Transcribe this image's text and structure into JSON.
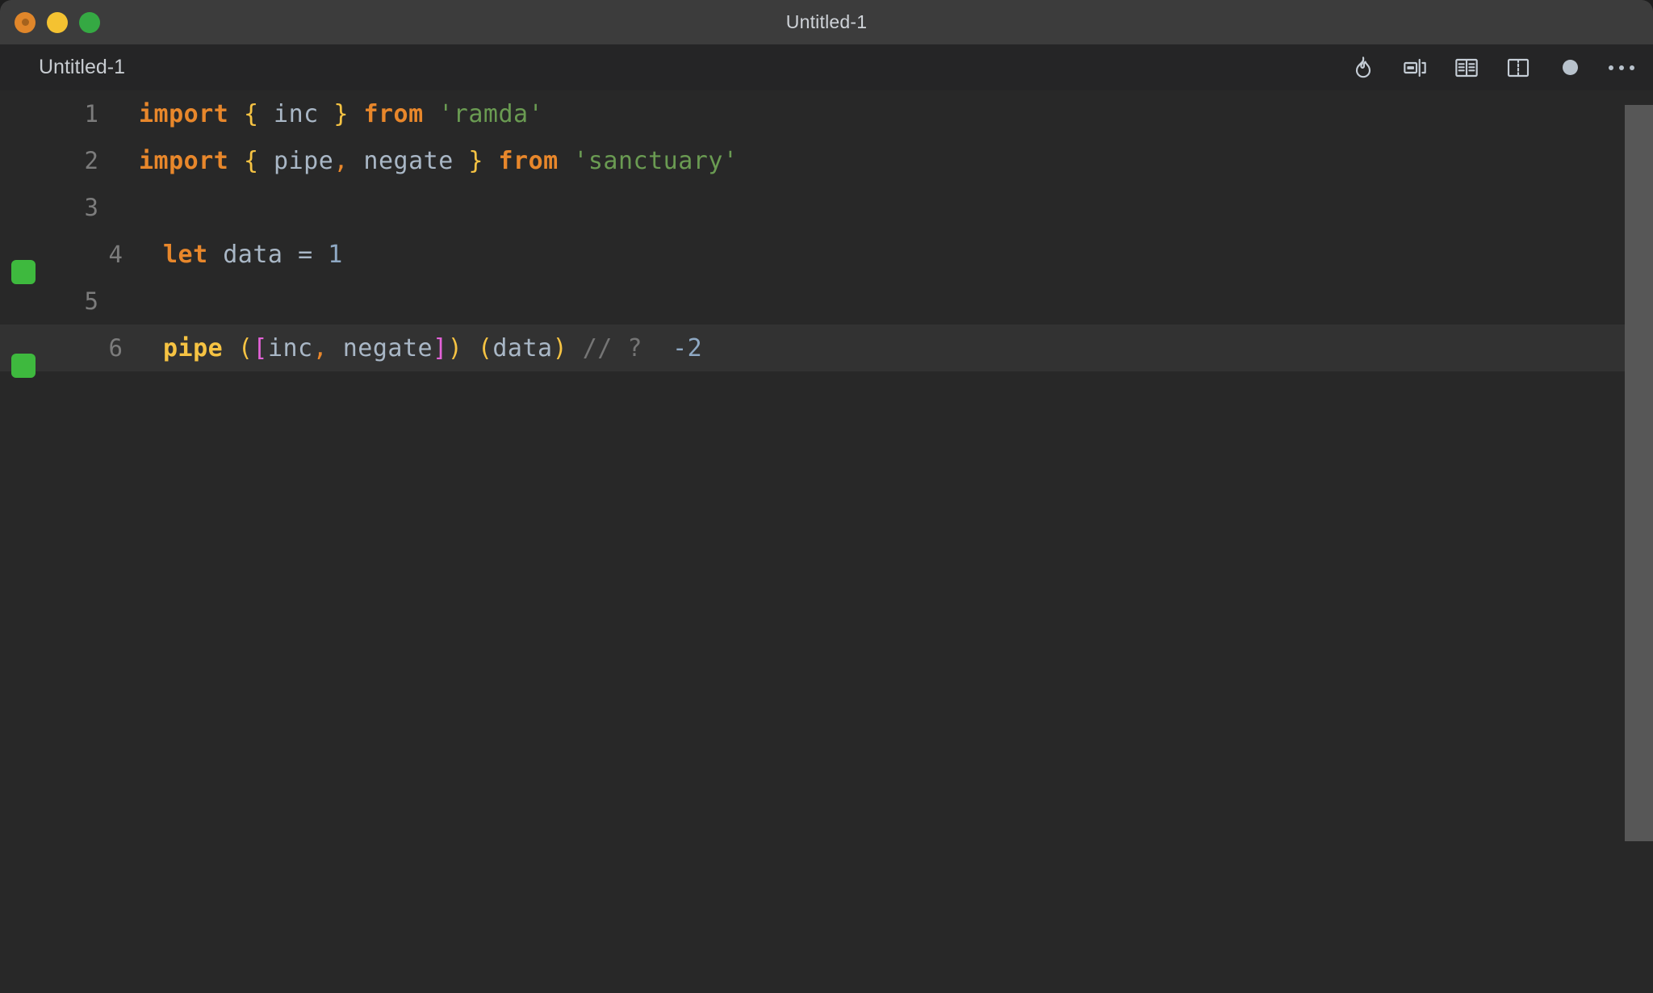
{
  "window": {
    "title": "Untitled-1",
    "traffic_lights": [
      {
        "name": "close",
        "color": "#e0862a"
      },
      {
        "name": "minimize",
        "color": "#f4c231"
      },
      {
        "name": "maximize",
        "color": "#35a943"
      }
    ]
  },
  "tab": {
    "label": "Untitled-1"
  },
  "toolbar": {
    "icons": [
      {
        "name": "flame-icon",
        "label": "Quokka"
      },
      {
        "name": "align-split-icon",
        "label": "Toggle Inline Values"
      },
      {
        "name": "open-book-icon",
        "label": "Open Docs"
      },
      {
        "name": "split-editor-icon",
        "label": "Split Editor"
      },
      {
        "name": "record-dot-icon",
        "label": "Record"
      },
      {
        "name": "more-actions-icon",
        "label": "More Actions..."
      }
    ]
  },
  "editor": {
    "theme": {
      "background": "#282828",
      "active_line": "#323232",
      "gutter_marker": "#3eb93e",
      "keyword": "#e8872b",
      "brace": "#f6c343",
      "identifier": "#a9b7c6",
      "string": "#6a9b52",
      "bracket": "#e362d8",
      "comment": "#757575",
      "number": "#8fa9c4",
      "scrollbar": "#575757"
    },
    "lines": [
      {
        "number": "1",
        "marker": false,
        "active": false,
        "tokens": [
          {
            "t": "import",
            "c": "t-kw"
          },
          {
            "t": " ",
            "c": "t-plain"
          },
          {
            "t": "{",
            "c": "t-brace"
          },
          {
            "t": " inc ",
            "c": "t-plain"
          },
          {
            "t": "}",
            "c": "t-brace"
          },
          {
            "t": " ",
            "c": "t-plain"
          },
          {
            "t": "from",
            "c": "t-kw"
          },
          {
            "t": " ",
            "c": "t-plain"
          },
          {
            "t": "'ramda'",
            "c": "t-string"
          }
        ]
      },
      {
        "number": "2",
        "marker": false,
        "active": false,
        "tokens": [
          {
            "t": "import",
            "c": "t-kw"
          },
          {
            "t": " ",
            "c": "t-plain"
          },
          {
            "t": "{",
            "c": "t-brace"
          },
          {
            "t": " pipe",
            "c": "t-plain"
          },
          {
            "t": ",",
            "c": "t-punct"
          },
          {
            "t": " negate ",
            "c": "t-plain"
          },
          {
            "t": "}",
            "c": "t-brace"
          },
          {
            "t": " ",
            "c": "t-plain"
          },
          {
            "t": "from",
            "c": "t-kw"
          },
          {
            "t": " ",
            "c": "t-plain"
          },
          {
            "t": "'sanctuary'",
            "c": "t-string"
          }
        ]
      },
      {
        "number": "3",
        "marker": false,
        "active": false,
        "tokens": []
      },
      {
        "number": "4",
        "marker": true,
        "active": false,
        "tokens": [
          {
            "t": "let",
            "c": "t-kw"
          },
          {
            "t": " data ",
            "c": "t-plain"
          },
          {
            "t": "=",
            "c": "t-plain"
          },
          {
            "t": " ",
            "c": "t-plain"
          },
          {
            "t": "1",
            "c": "t-num"
          }
        ]
      },
      {
        "number": "5",
        "marker": false,
        "active": false,
        "tokens": []
      },
      {
        "number": "6",
        "marker": true,
        "active": true,
        "tokens": [
          {
            "t": "pipe",
            "c": "t-fn"
          },
          {
            "t": " ",
            "c": "t-plain"
          },
          {
            "t": "(",
            "c": "t-paren"
          },
          {
            "t": "[",
            "c": "t-bracket"
          },
          {
            "t": "inc",
            "c": "t-plain"
          },
          {
            "t": ",",
            "c": "t-punct"
          },
          {
            "t": " negate",
            "c": "t-plain"
          },
          {
            "t": "]",
            "c": "t-bracket"
          },
          {
            "t": ")",
            "c": "t-paren"
          },
          {
            "t": " ",
            "c": "t-plain"
          },
          {
            "t": "(",
            "c": "t-paren"
          },
          {
            "t": "data",
            "c": "t-plain"
          },
          {
            "t": ")",
            "c": "t-paren"
          },
          {
            "t": " ",
            "c": "t-plain"
          },
          {
            "t": "// ?",
            "c": "t-comment"
          },
          {
            "t": "  ",
            "c": "t-plain"
          },
          {
            "t": "-2",
            "c": "t-result"
          }
        ]
      }
    ]
  }
}
